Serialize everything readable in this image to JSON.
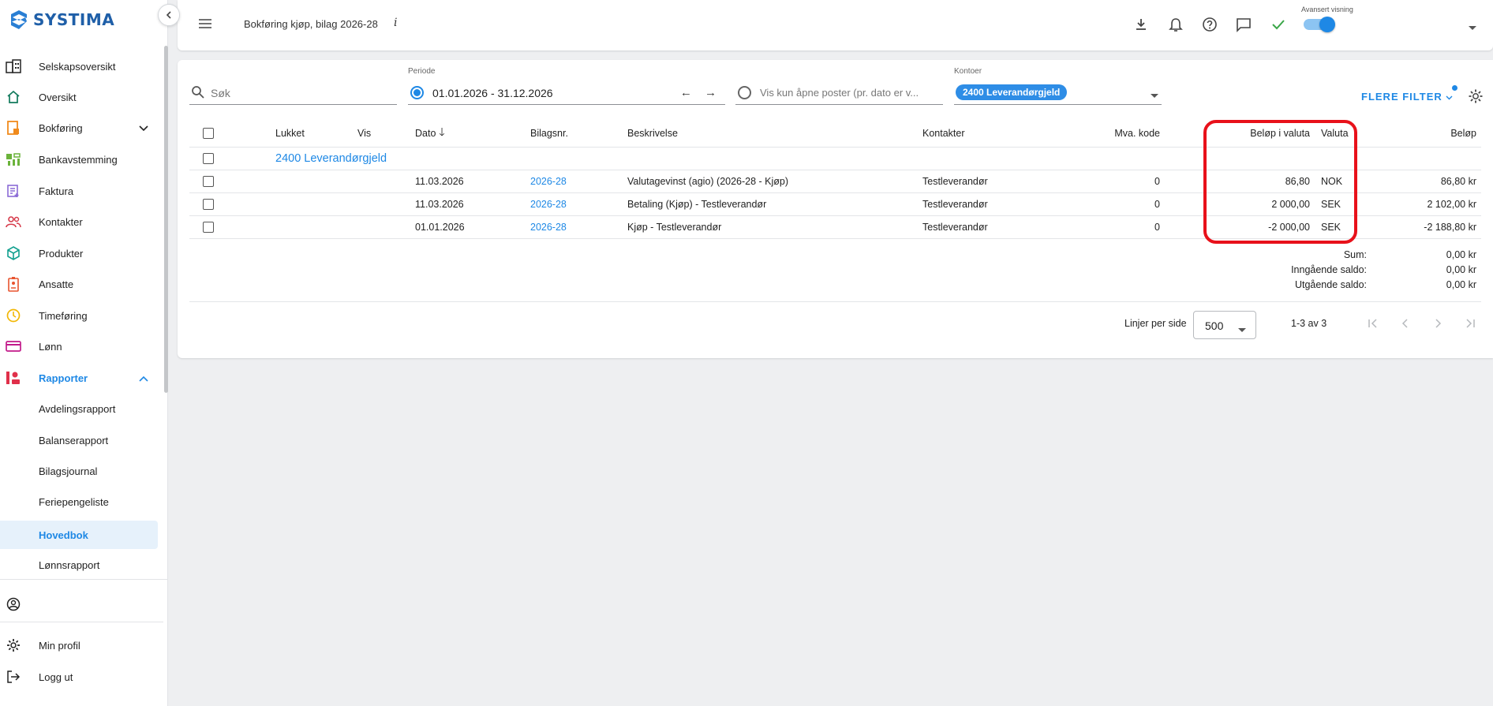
{
  "brand": {
    "name": "SYSTIMA",
    "color": "#1f5fa8"
  },
  "accent": "#1e88e5",
  "sidebar": {
    "items": [
      {
        "label": "Selskapsoversikt",
        "icon": "buildings-icon"
      },
      {
        "label": "Oversikt",
        "icon": "home-icon"
      },
      {
        "label": "Bokføring",
        "icon": "ledger-icon",
        "expandable": true
      },
      {
        "label": "Bankavstemming",
        "icon": "bank-icon"
      },
      {
        "label": "Faktura",
        "icon": "invoice-icon"
      },
      {
        "label": "Kontakter",
        "icon": "contacts-icon"
      },
      {
        "label": "Produkter",
        "icon": "box-icon"
      },
      {
        "label": "Ansatte",
        "icon": "badge-icon"
      },
      {
        "label": "Timeføring",
        "icon": "clock-icon"
      },
      {
        "label": "Lønn",
        "icon": "card-icon"
      },
      {
        "label": "Rapporter",
        "icon": "chart-icon",
        "expanded": true
      }
    ],
    "subitems": [
      "Avdelingsrapport",
      "Balanserapport",
      "Bilagsjournal",
      "Feriepengeliste",
      "Hovedbok",
      "Lønnsrapport"
    ],
    "selected": "Hovedbok",
    "bottom": [
      {
        "label": "",
        "icon": "user-circle-icon"
      },
      {
        "label": "Min profil",
        "icon": "gear-icon"
      },
      {
        "label": "Logg ut",
        "icon": "logout-icon"
      }
    ]
  },
  "topbar": {
    "title": "Bokføring kjøp, bilag 2026-28",
    "info": "i",
    "advanced_label": "Avansert visning",
    "advanced_on": true
  },
  "filters": {
    "search_placeholder": "Søk",
    "period_label": "Periode",
    "period_value": "01.01.2026 - 31.12.2026",
    "period_arrows": "← →",
    "open_posts_placeholder": "Vis kun åpne poster (pr. dato er v...",
    "accounts_label": "Kontoer",
    "accounts_chip": "2400 Leverandørgjeld",
    "more_filters": "FLERE FILTER"
  },
  "table": {
    "headers": {
      "closed": "Lukket",
      "show": "Vis",
      "date": "Dato",
      "voucher": "Bilagsnr.",
      "description": "Beskrivelse",
      "contacts": "Kontakter",
      "vat": "Mva. kode",
      "amount_currency": "Beløp i valuta",
      "currency": "Valuta",
      "amount": "Beløp"
    },
    "group": "2400 Leverandørgjeld",
    "rows": [
      {
        "date": "11.03.2026",
        "voucher": "2026-28",
        "description": "Valutagevinst (agio) (2026-28 - Kjøp)",
        "contact": "Testleverandør",
        "vat": "0",
        "amount_currency": "86,80",
        "currency": "NOK",
        "amount": "86,80 kr"
      },
      {
        "date": "11.03.2026",
        "voucher": "2026-28",
        "description": "Betaling (Kjøp) - Testleverandør",
        "contact": "Testleverandør",
        "vat": "0",
        "amount_currency": "2 000,00",
        "currency": "SEK",
        "amount": "2 102,00 kr"
      },
      {
        "date": "01.01.2026",
        "voucher": "2026-28",
        "description": "Kjøp - Testleverandør",
        "contact": "Testleverandør",
        "vat": "0",
        "amount_currency": "-2 000,00",
        "currency": "SEK",
        "amount": "-2 188,80 kr"
      }
    ],
    "sums": [
      {
        "label": "Sum:",
        "value": "0,00 kr"
      },
      {
        "label": "Inngående saldo:",
        "value": "0,00 kr"
      },
      {
        "label": "Utgående saldo:",
        "value": "0,00 kr"
      }
    ]
  },
  "pagination": {
    "lines_label": "Linjer per side",
    "lines_value": "500",
    "range": "1-3 av 3"
  },
  "highlight_color": "#e8111a"
}
